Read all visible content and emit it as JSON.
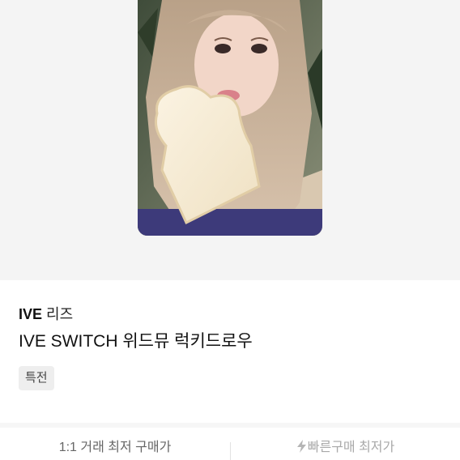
{
  "product": {
    "brand": "IVE",
    "member": "리즈",
    "title": "IVE SWITCH 위드뮤 럭키드로우",
    "tag": "특전",
    "image_icon": "photocard-image"
  },
  "bottom_bar": {
    "left_label": "1:1 거래 최저 구매가",
    "right_label": "빠른구매 최저가",
    "right_icon": "lightning-bolt-icon"
  },
  "colors": {
    "image_background": "#f4f4f4",
    "tag_background": "#eeeeee",
    "muted_text": "#a9a9a9"
  }
}
